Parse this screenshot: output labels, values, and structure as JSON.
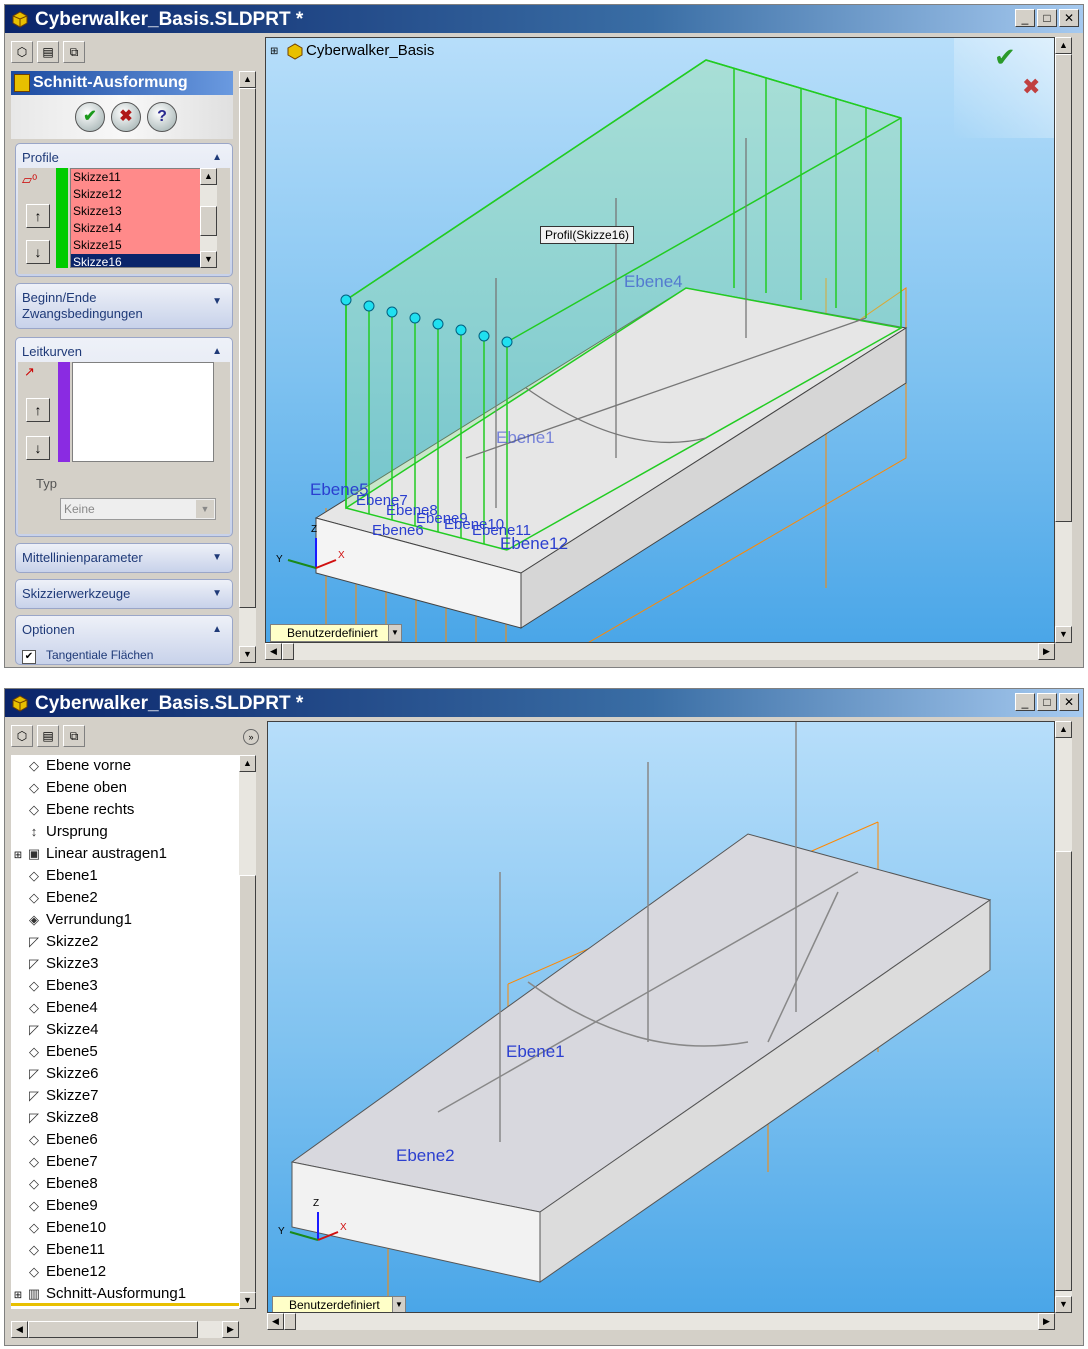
{
  "window1": {
    "title": "Cyberwalker_Basis.SLDPRT *",
    "property_manager": {
      "title": "Schnitt-Ausformung",
      "groups": {
        "profile": {
          "label": "Profile",
          "items": [
            "Skizze11",
            "Skizze12",
            "Skizze13",
            "Skizze14",
            "Skizze15",
            "Skizze16"
          ],
          "selection_color": "#ff8080"
        },
        "begin_end": {
          "label": "Beginn/Ende Zwangsbedingungen"
        },
        "leitkurven": {
          "label": "Leitkurven",
          "typ_label": "Typ",
          "typ_value": "Keine"
        },
        "mittellinie": {
          "label": "Mittellinienparameter"
        },
        "skizzier": {
          "label": "Skizzierwerkzeuge"
        },
        "optionen": {
          "label": "Optionen",
          "checkbox_label": "Tangentiale Flächen",
          "checkbox_checked": true
        }
      }
    },
    "viewport": {
      "tree_root": "Cyberwalker_Basis",
      "tooltip": "Profil(Skizze16)",
      "plane_labels": [
        "Ebene4",
        "Ebene1",
        "Ebene5",
        "Ebene7",
        "Ebene8",
        "Ebene9",
        "Ebene10",
        "Ebene11",
        "Ebene12",
        "Ebene6"
      ],
      "view_dropdown": "Benutzerdefiniert",
      "triad": {
        "x": "X",
        "y": "Y",
        "z": "Z"
      }
    }
  },
  "window2": {
    "title": "Cyberwalker_Basis.SLDPRT *",
    "feature_tree": [
      {
        "icon": "plane-icon",
        "label": "Ebene vorne"
      },
      {
        "icon": "plane-icon",
        "label": "Ebene oben"
      },
      {
        "icon": "plane-icon",
        "label": "Ebene rechts"
      },
      {
        "icon": "origin-icon",
        "label": "Ursprung"
      },
      {
        "icon": "extrude-icon",
        "label": "Linear austragen1",
        "expandable": true
      },
      {
        "icon": "plane-icon",
        "label": "Ebene1"
      },
      {
        "icon": "plane-icon",
        "label": "Ebene2"
      },
      {
        "icon": "fillet-icon",
        "label": "Verrundung1"
      },
      {
        "icon": "sketch-icon",
        "label": "Skizze2"
      },
      {
        "icon": "sketch-icon",
        "label": "Skizze3"
      },
      {
        "icon": "plane-icon",
        "label": "Ebene3"
      },
      {
        "icon": "plane-icon",
        "label": "Ebene4"
      },
      {
        "icon": "sketch-icon",
        "label": "Skizze4"
      },
      {
        "icon": "plane-icon",
        "label": "Ebene5"
      },
      {
        "icon": "sketch-icon",
        "label": "Skizze6"
      },
      {
        "icon": "sketch-icon",
        "label": "Skizze7"
      },
      {
        "icon": "sketch-icon",
        "label": "Skizze8"
      },
      {
        "icon": "plane-icon",
        "label": "Ebene6"
      },
      {
        "icon": "plane-icon",
        "label": "Ebene7"
      },
      {
        "icon": "plane-icon",
        "label": "Ebene8"
      },
      {
        "icon": "plane-icon",
        "label": "Ebene9"
      },
      {
        "icon": "plane-icon",
        "label": "Ebene10"
      },
      {
        "icon": "plane-icon",
        "label": "Ebene11"
      },
      {
        "icon": "plane-icon",
        "label": "Ebene12"
      },
      {
        "icon": "loft-icon",
        "label": "Schnitt-Ausformung1",
        "expandable": true
      }
    ],
    "viewport": {
      "plane_labels": [
        "Ebene1",
        "Ebene2"
      ],
      "view_dropdown": "Benutzerdefiniert",
      "triad": {
        "x": "X",
        "y": "Y",
        "z": "Z"
      }
    }
  },
  "colors": {
    "titlebar": "#0a246a",
    "loft_green": "#22cc22",
    "plane_orange": "#ff8800",
    "label_blue": "#2b3fcf"
  }
}
